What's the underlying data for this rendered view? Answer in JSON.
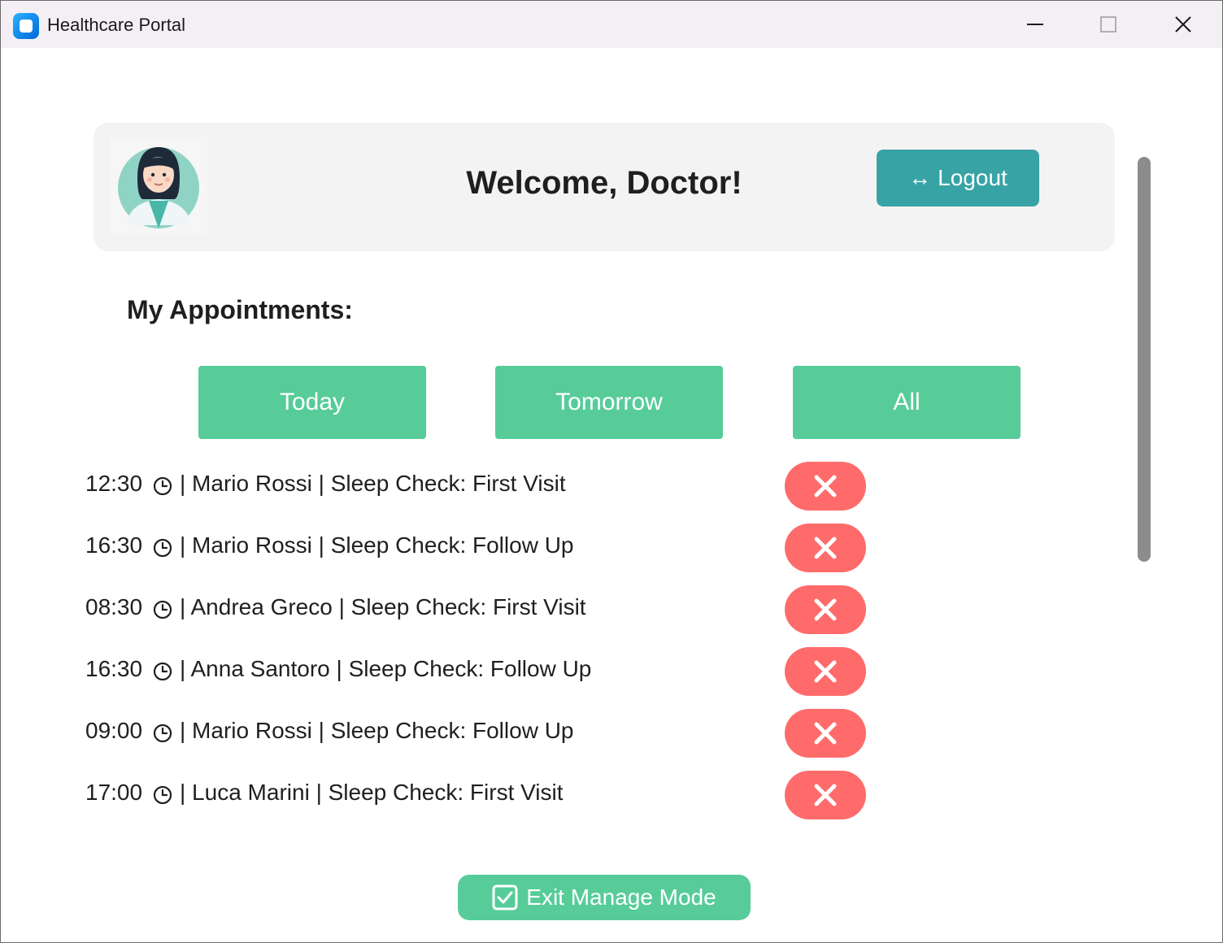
{
  "window": {
    "title": "Healthcare Portal"
  },
  "header": {
    "welcome": "Welcome, Doctor!",
    "logout_label": "Logout",
    "logout_icon": "↔"
  },
  "appointments": {
    "title": "My Appointments:",
    "filters": {
      "today": "Today",
      "tomorrow": "Tomorrow",
      "all": "All"
    },
    "items": [
      {
        "time": "12:30",
        "details": "| Mario Rossi | Sleep Check: First Visit"
      },
      {
        "time": "16:30",
        "details": "| Mario Rossi | Sleep Check: Follow Up"
      },
      {
        "time": "08:30",
        "details": "| Andrea Greco | Sleep Check: First Visit"
      },
      {
        "time": "16:30",
        "details": "| Anna Santoro | Sleep Check: Follow Up"
      },
      {
        "time": "09:00",
        "details": "| Mario Rossi | Sleep Check: Follow Up"
      },
      {
        "time": "17:00",
        "details": "| Luca Marini | Sleep Check: First Visit"
      }
    ]
  },
  "footer": {
    "exit_label": "Exit Manage Mode"
  },
  "colors": {
    "accent_teal": "#38a3a5",
    "accent_green": "#57cc99",
    "delete_red": "#ff6b6b"
  },
  "icons": {
    "clock": "clock-icon",
    "delete": "close-x-icon",
    "logout": "logout-arrow-icon",
    "exit": "checkbox-icon"
  }
}
